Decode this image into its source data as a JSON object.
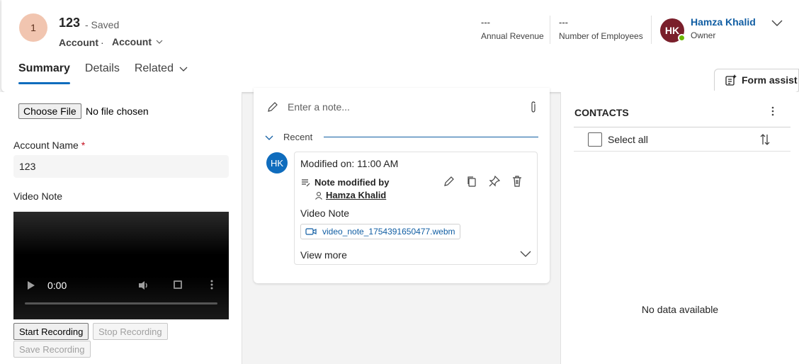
{
  "header": {
    "avatar_initials": "1",
    "record_title": "123",
    "saved_status": "- Saved",
    "entity_type": "Account",
    "separator": "·",
    "form_name": "Account",
    "kpis": [
      {
        "value": "---",
        "label": "Annual Revenue"
      },
      {
        "value": "---",
        "label": "Number of Employees"
      }
    ],
    "owner": {
      "initials": "HK",
      "name": "Hamza Khalid",
      "role": "Owner"
    },
    "tabs": [
      {
        "label": "Summary",
        "active": true
      },
      {
        "label": "Details",
        "active": false
      },
      {
        "label": "Related",
        "active": false
      }
    ],
    "form_assist_label": "Form assist"
  },
  "left": {
    "choose_file_label": "Choose File",
    "no_file_text": "No file chosen",
    "account_name_label": "Account Name",
    "required_marker": "*",
    "account_name_value": "123",
    "video_note_label": "Video Note",
    "video_time": "0:00",
    "start_recording": "Start Recording",
    "stop_recording": "Stop Recording",
    "save_recording": "Save Recording"
  },
  "timeline": {
    "note_placeholder": "Enter a note...",
    "recent_label": "Recent",
    "entry": {
      "avatar_initials": "HK",
      "modified_on": "Modified on: 11:00 AM",
      "title": "Note modified by",
      "author": "Hamza Khalid",
      "subject": "Video Note",
      "attachment": "video_note_1754391650477.webm",
      "view_more": "View more"
    }
  },
  "contacts": {
    "title": "CONTACTS",
    "select_all": "Select all",
    "empty_text": "No data available"
  },
  "colors": {
    "accent": "#0f6cbd",
    "owner_avatar": "#7a1f2b",
    "entity_avatar": "#f1c5b0",
    "presence": "#6bb700",
    "required": "#c50f1f"
  }
}
